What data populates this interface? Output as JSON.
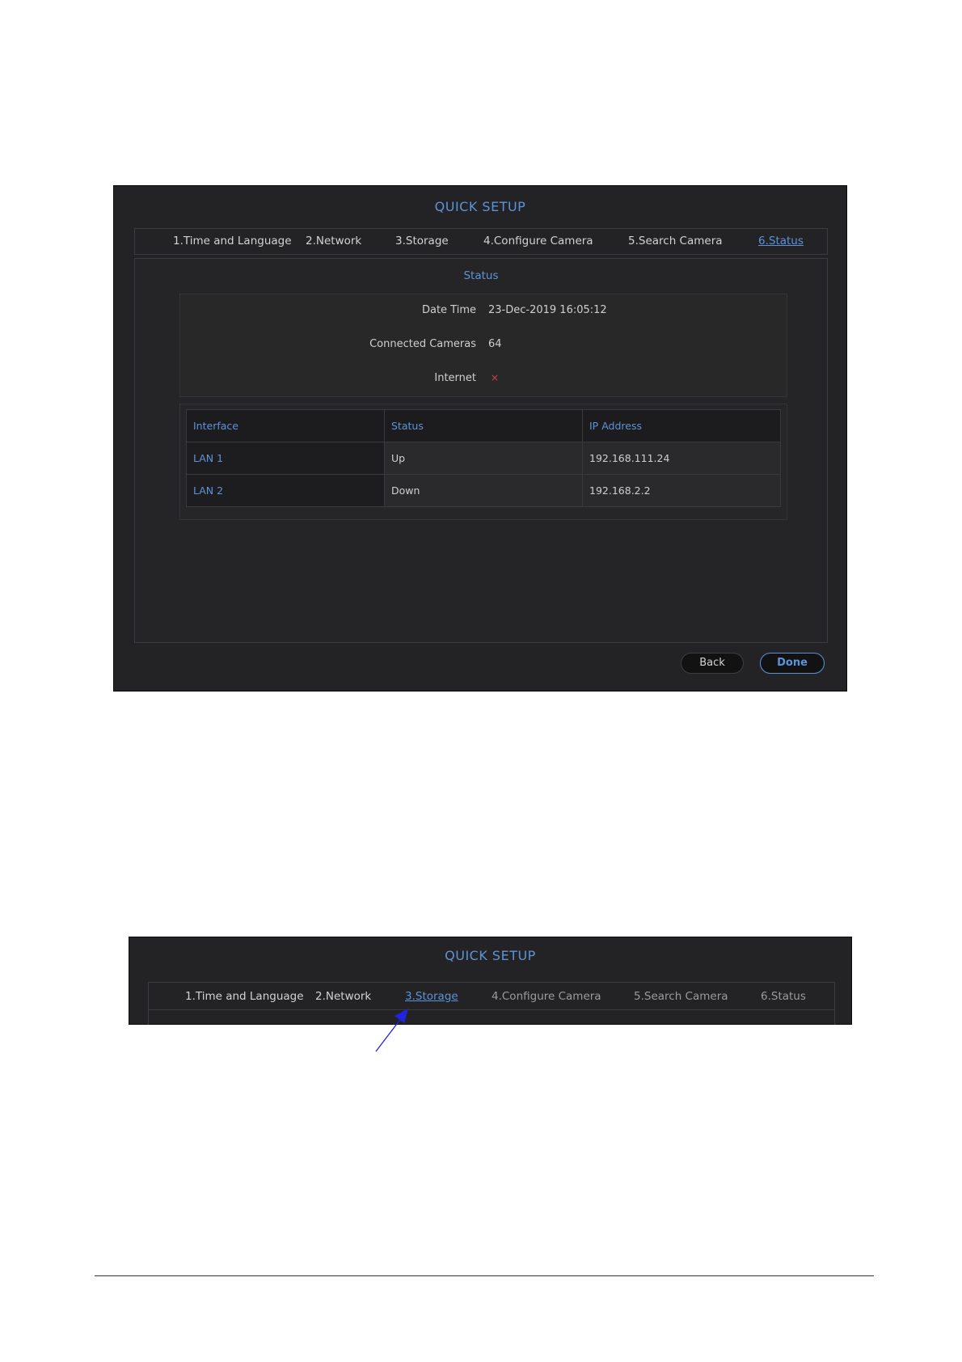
{
  "screenshot1": {
    "title": "QUICK SETUP",
    "steps": [
      {
        "label": "1.Time and Language"
      },
      {
        "label": "2.Network"
      },
      {
        "label": "3.Storage"
      },
      {
        "label": "4.Configure Camera"
      },
      {
        "label": "5.Search Camera"
      },
      {
        "label": "6.Status"
      }
    ],
    "active_step": "6.Status",
    "section_title": "Status",
    "info": {
      "date_time_label": "Date Time",
      "date_time_value": "23-Dec-2019 16:05:12",
      "connected_cameras_label": "Connected Cameras",
      "connected_cameras_value": "64",
      "internet_label": "Internet",
      "internet_value": "×"
    },
    "table": {
      "headers": [
        "Interface",
        "Status",
        "IP Address"
      ],
      "rows": [
        [
          "LAN 1",
          "Up",
          "192.168.111.24"
        ],
        [
          "LAN 2",
          "Down",
          "192.168.2.2"
        ]
      ]
    },
    "buttons": {
      "back": "Back",
      "done": "Done"
    }
  },
  "screenshot2": {
    "title": "QUICK SETUP",
    "steps": [
      {
        "label": "1.Time and Language"
      },
      {
        "label": "2.Network"
      },
      {
        "label": "3.Storage"
      },
      {
        "label": "4.Configure Camera"
      },
      {
        "label": "5.Search Camera"
      },
      {
        "label": "6.Status"
      }
    ],
    "active_step": "3.Storage",
    "annotation_color": "#1f24e0"
  },
  "colors": {
    "accent": "#5d93d8",
    "panel": "#232325",
    "error": "#d04444"
  }
}
